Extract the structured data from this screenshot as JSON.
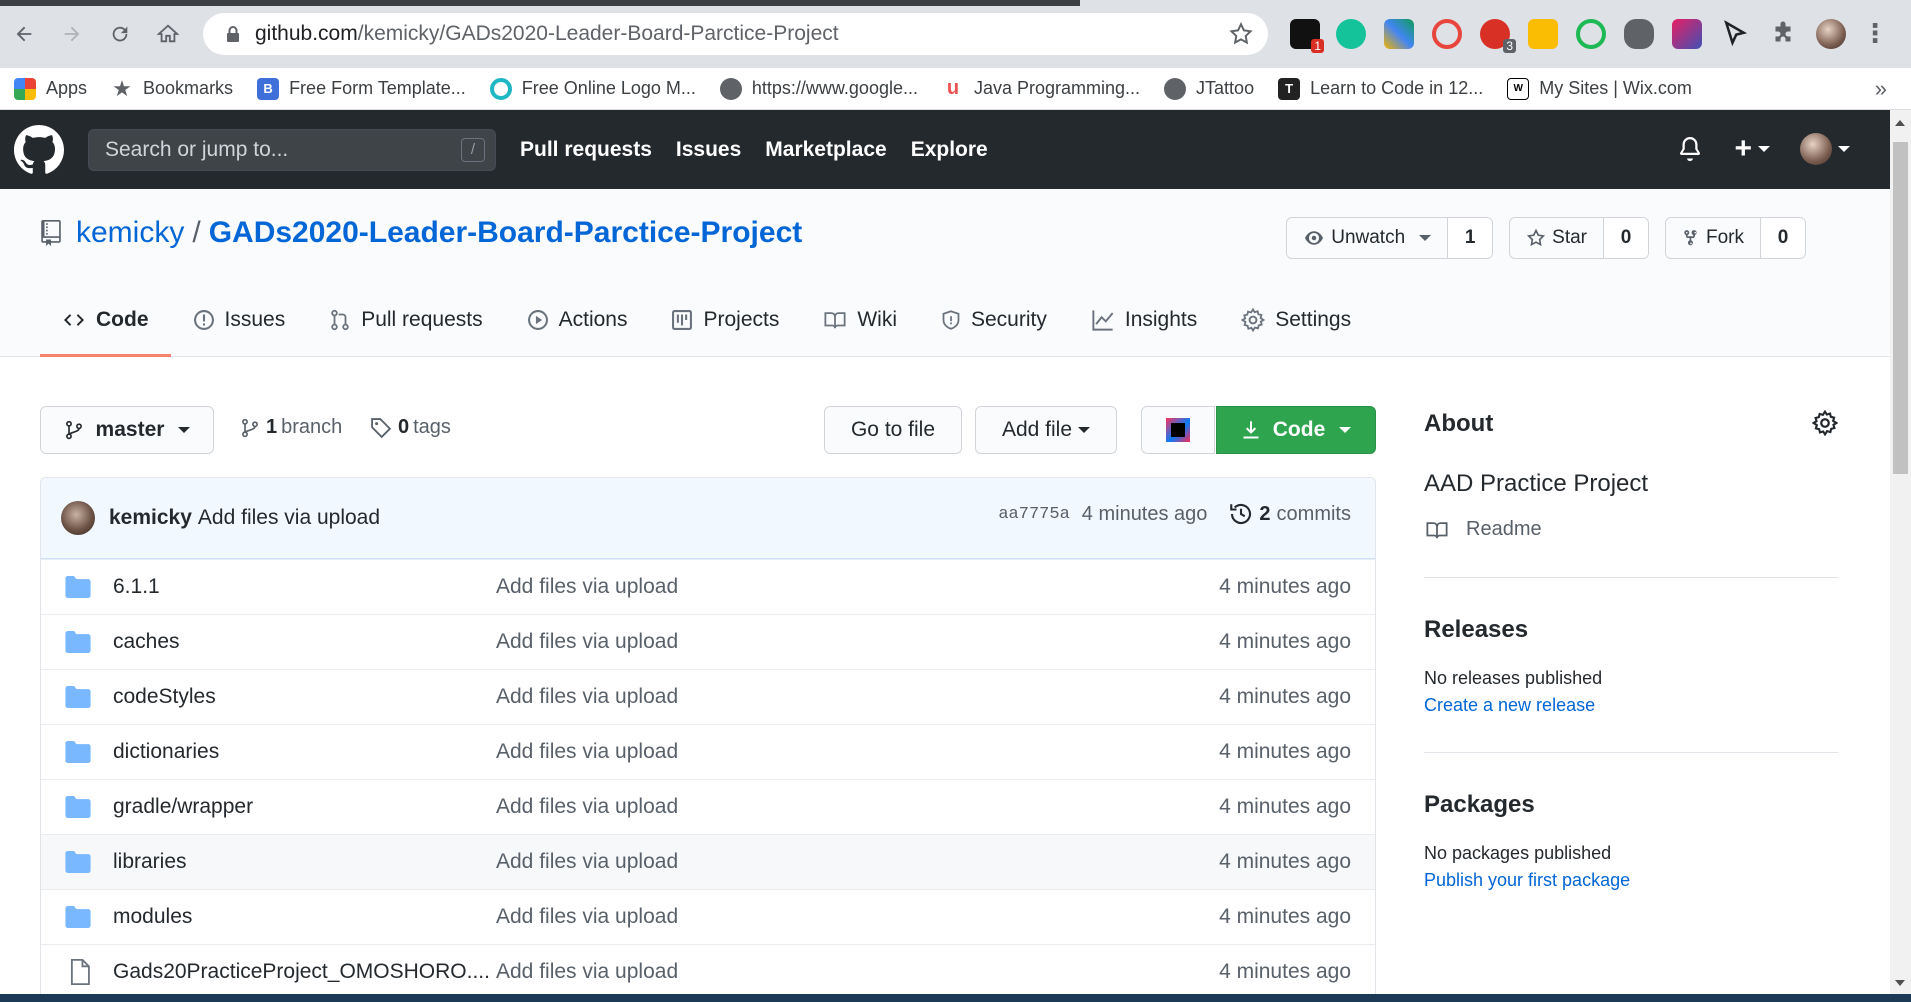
{
  "browser": {
    "url_host": "github.com",
    "url_path": "/kemicky/GADs2020-Leader-Board-Parctice-Project",
    "bookmarks": [
      "Apps",
      "Bookmarks",
      "Free Form Template...",
      "Free Online Logo M...",
      "https://www.google...",
      "Java Programming...",
      "JTattoo",
      "Learn to Code in 12...",
      "My Sites | Wix.com"
    ],
    "bookmarks_more": "»",
    "ext_badge_1": "1",
    "ext_badge_2": "3"
  },
  "gh": {
    "search_placeholder": "Search or jump to...",
    "slash_key": "/",
    "nav": [
      "Pull requests",
      "Issues",
      "Marketplace",
      "Explore"
    ],
    "plus": "+"
  },
  "repo": {
    "owner": "kemicky",
    "separator": "/",
    "name": "GADs2020-Leader-Board-Parctice-Project",
    "watch_label": "Unwatch",
    "watch_count": "1",
    "star_label": "Star",
    "star_count": "0",
    "fork_label": "Fork",
    "fork_count": "0",
    "tabs": [
      "Code",
      "Issues",
      "Pull requests",
      "Actions",
      "Projects",
      "Wiki",
      "Security",
      "Insights",
      "Settings"
    ]
  },
  "filenav": {
    "branch": "master",
    "branches_count": "1",
    "branches_label": "branch",
    "tags_count": "0",
    "tags_label": "tags",
    "go_to_file": "Go to file",
    "add_file": "Add file",
    "code": "Code"
  },
  "commit": {
    "author": "kemicky",
    "message": "Add files via upload",
    "sha": "aa7775a",
    "time": "4 minutes ago",
    "commits_count": "2",
    "commits_label": "commits"
  },
  "files": [
    {
      "name": "6.1.1",
      "type": "dir",
      "message": "Add files via upload",
      "time": "4 minutes ago"
    },
    {
      "name": "caches",
      "type": "dir",
      "message": "Add files via upload",
      "time": "4 minutes ago"
    },
    {
      "name": "codeStyles",
      "type": "dir",
      "message": "Add files via upload",
      "time": "4 minutes ago"
    },
    {
      "name": "dictionaries",
      "type": "dir",
      "message": "Add files via upload",
      "time": "4 minutes ago"
    },
    {
      "name": "gradle/wrapper",
      "type": "dir",
      "message": "Add files via upload",
      "time": "4 minutes ago"
    },
    {
      "name": "libraries",
      "type": "dir",
      "message": "Add files via upload",
      "time": "4 minutes ago"
    },
    {
      "name": "modules",
      "type": "dir",
      "message": "Add files via upload",
      "time": "4 minutes ago"
    },
    {
      "name": "Gads20PracticeProject_OMOSHORO....",
      "type": "file",
      "message": "Add files via upload",
      "time": "4 minutes ago"
    }
  ],
  "about": {
    "heading": "About",
    "description": "AAD Practice Project",
    "readme": "Readme"
  },
  "releases": {
    "heading": "Releases",
    "none": "No releases published",
    "create_link": "Create a new release"
  },
  "packages": {
    "heading": "Packages",
    "none": "No packages published",
    "publish_link": "Publish your first package"
  }
}
